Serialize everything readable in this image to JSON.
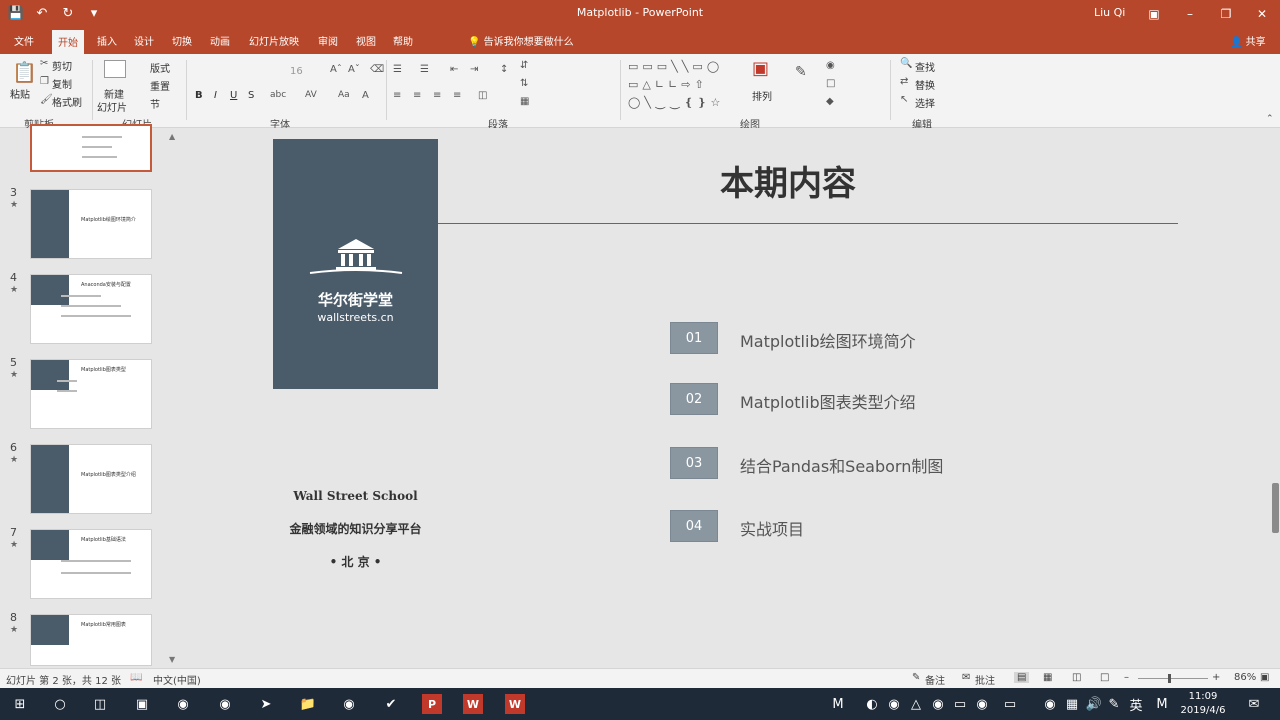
{
  "window": {
    "title": "Matplotlib - PowerPoint",
    "user": "Liu Qi"
  },
  "tabs": {
    "items": [
      "文件",
      "开始",
      "插入",
      "设计",
      "切换",
      "动画",
      "幻灯片放映",
      "审阅",
      "视图",
      "帮助"
    ],
    "active": "开始",
    "tell_me": "告诉我你想要做什么",
    "share": "共享"
  },
  "ribbon": {
    "clipboard": {
      "paste": "粘贴",
      "cut": "剪切",
      "copy": "复制",
      "format_painter": "格式刷",
      "label": "剪贴板"
    },
    "slides": {
      "new_slide": "新建",
      "new_slide2": "幻灯片",
      "layout": "版式",
      "reset": "重置",
      "section": "节",
      "label": "幻灯片"
    },
    "font": {
      "size": "16",
      "bold": "B",
      "italic": "I",
      "underline": "U",
      "strike": "S",
      "label": "字体"
    },
    "paragraph": {
      "label": "段落"
    },
    "drawing": {
      "arrange": "排列",
      "label": "绘图"
    },
    "editing": {
      "find": "查找",
      "replace": "替换",
      "select": "选择",
      "label": "编辑"
    }
  },
  "thumbnails": [
    {
      "num": "3",
      "title": "Matplotlib绘图环境简介"
    },
    {
      "num": "4",
      "title": "Anaconda安装与配置"
    },
    {
      "num": "5",
      "title": "Matplotlib图表类型"
    },
    {
      "num": "6",
      "title": "Matplotlib图表类型介绍"
    },
    {
      "num": "7",
      "title": "Matplotlib基础语法"
    },
    {
      "num": "8",
      "title": "Matplotlib常用图表"
    }
  ],
  "slide": {
    "logo_cn": "华尔街学堂",
    "logo_en": "wallstreets.cn",
    "school_en": "Wall Street School",
    "school_cn": "金融领域的知识分享平台",
    "city": "• 北 京 •",
    "headline": "本期内容",
    "agenda": [
      {
        "num": "01",
        "text": "Matplotlib绘图环境简介"
      },
      {
        "num": "02",
        "text": "Matplotlib图表类型介绍"
      },
      {
        "num": "03",
        "text": "结合Pandas和Seaborn制图"
      },
      {
        "num": "04",
        "text": "实战项目"
      }
    ]
  },
  "status": {
    "slide_info": "幻灯片 第 2 张，共 12 张",
    "language": "中文(中国)",
    "notes": "备注",
    "comments": "批注",
    "zoom": "86%"
  },
  "taskbar": {
    "time": "11:09",
    "date": "2019/4/6",
    "ime": "英"
  }
}
